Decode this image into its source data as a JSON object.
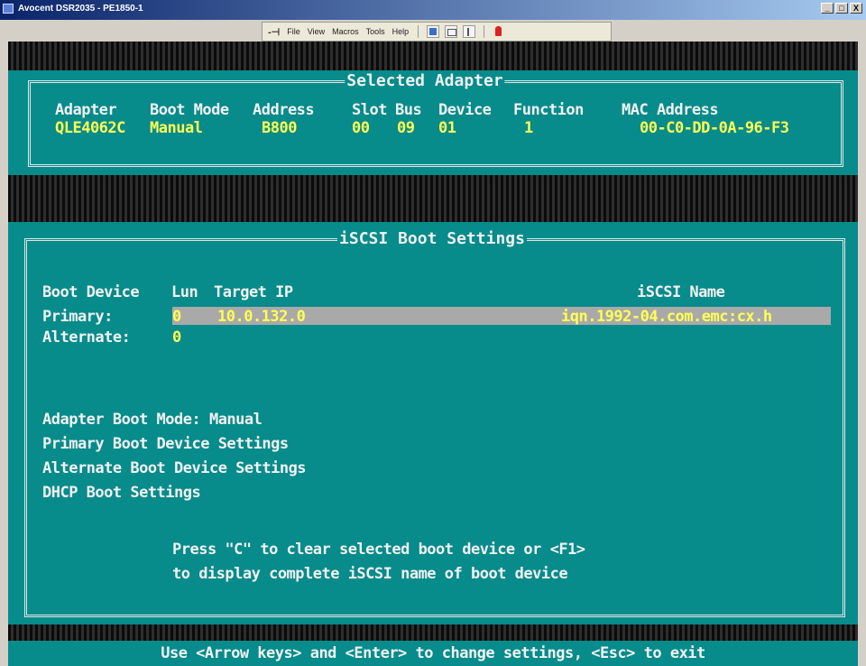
{
  "window": {
    "title": "Avocent DSR2035 - PE1850-1",
    "minimize": "_",
    "maximize": "□",
    "close": "X"
  },
  "menubar": {
    "pin": "-⊣",
    "items": [
      "File",
      "View",
      "Macros",
      "Tools",
      "Help"
    ],
    "icons": [
      "single-cursor-icon",
      "screen-icon",
      "scaling-icon",
      "power-icon"
    ]
  },
  "selected_adapter": {
    "title": "Selected Adapter",
    "headers": [
      "Adapter",
      "Boot Mode",
      "Address",
      "Slot",
      "Bus",
      "Device",
      "Function",
      "MAC Address"
    ],
    "values": [
      "QLE4062C",
      "Manual",
      "B800",
      "00",
      "09",
      "01",
      "1",
      "00-C0-DD-0A-96-F3"
    ]
  },
  "iscsi": {
    "title": "iSCSI Boot Settings",
    "table_headers": {
      "boot_device": "Boot Device",
      "lun": "Lun",
      "target_ip": "Target IP",
      "iscsi_name": "iSCSI Name"
    },
    "rows": [
      {
        "device": "Primary:",
        "lun": "0",
        "ip": "10.0.132.0",
        "name": "iqn.1992-04.com.emc:cx.h"
      },
      {
        "device": "Alternate:",
        "lun": "0",
        "ip": "",
        "name": ""
      }
    ],
    "menu": [
      "Adapter Boot Mode: Manual",
      "Primary Boot Device Settings",
      "Alternate Boot Device Settings",
      "DHCP Boot Settings"
    ],
    "hint_line1": "Press \"C\" to clear selected boot device or <F1>",
    "hint_line2": "to display complete iSCSI name of boot device"
  },
  "status_bar": "Use <Arrow keys> and <Enter> to change settings, <Esc> to exit",
  "colors": {
    "panel": "#078b8b",
    "highlight": "#a9a9a9",
    "value_text": "#ffff55",
    "label_text": "#f2f2f2"
  }
}
